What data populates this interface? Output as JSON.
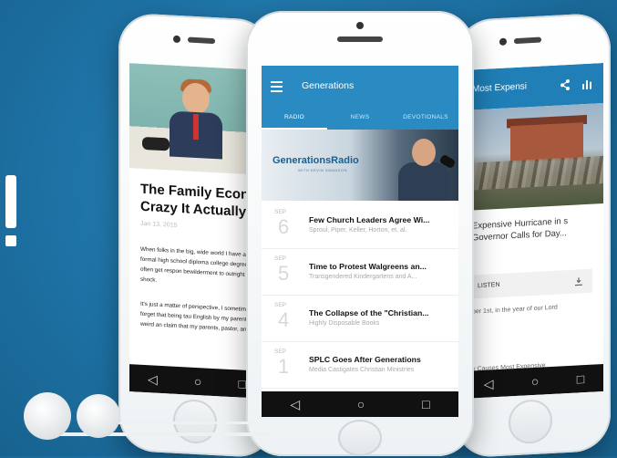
{
  "left_phone": {
    "headline": "The Family Econ Crazy It Actually",
    "date": "Jan 13, 2015",
    "para1": "When folks in the big, wide world I have a formal high school diploma college degree, I often get respon bewilderment to outright shock.",
    "para2": "It's just a matter of perspective, I sometimes forget that being tau English by my parents is weird an claim that my parents, pastor, and",
    "nav": [
      "◁",
      "○",
      "□"
    ]
  },
  "center_phone": {
    "app_title": "Generations",
    "tabs": [
      "RADIO",
      "NEWS",
      "DEVOTIONALS"
    ],
    "banner_logo": "GenerationsRadio",
    "banner_sub": "WITH KEVIN SWANSON",
    "episodes": [
      {
        "month": "SEP",
        "day": "6",
        "title": "Few Church Leaders Agree Wi...",
        "subtitle": "Sproul, Piper, Keller, Horton, et. al."
      },
      {
        "month": "SEP",
        "day": "5",
        "title": "Time to Protest Walgreens an...",
        "subtitle": "Transgendered Kindergartens and A..."
      },
      {
        "month": "SEP",
        "day": "4",
        "title": "The Collapse of the \"Christian...",
        "subtitle": "Highly Disposable Books"
      },
      {
        "month": "SEP",
        "day": "1",
        "title": "SPLC Goes After Generations",
        "subtitle": "Media Castigates Christian Ministries"
      }
    ],
    "nav": [
      "◁",
      "○",
      "□"
    ]
  },
  "right_phone": {
    "title": "Most Expensi",
    "headline": "Expensive Hurricane in s Governor Calls for Day...",
    "listen_label": "LISTEN",
    "text1": "ber 1st, in the year of our Lord",
    "text2": "y Causes Most Expensive",
    "nav": [
      "◁",
      "○",
      "□"
    ]
  },
  "colors": {
    "background": "#1e73a6",
    "appbar": "#2a8bc3"
  }
}
